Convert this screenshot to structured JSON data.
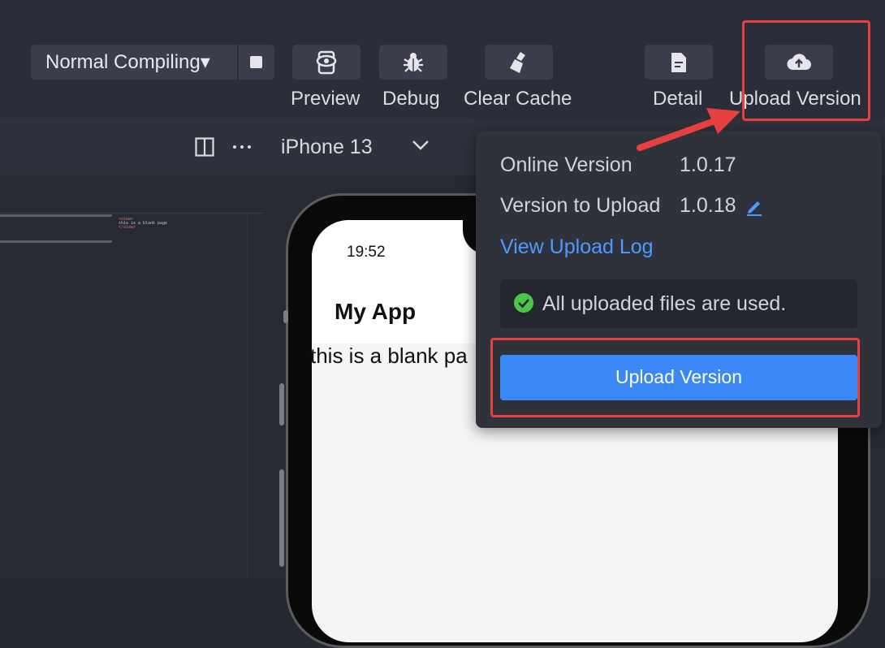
{
  "toolbar": {
    "compile_mode": "Normal Compiling▾",
    "buttons": [
      {
        "label": "Preview",
        "icon": "eye-preview-icon"
      },
      {
        "label": "Debug",
        "icon": "bug-icon"
      },
      {
        "label": "Clear Cache",
        "icon": "broom-icon"
      },
      {
        "label": "Detail",
        "icon": "document-icon"
      },
      {
        "label": "Upload Version",
        "icon": "cloud-upload-icon"
      }
    ]
  },
  "simulator_bar": {
    "device": "iPhone 13"
  },
  "code_editor": {
    "lines": [
      "<view>",
      "  this is a blank page",
      "</view>"
    ]
  },
  "phone": {
    "time": "19:52",
    "app_title": "My App",
    "page_text": "this is a blank pa"
  },
  "upload_popup": {
    "online_version_label": "Online Version",
    "online_version_value": "1.0.17",
    "upload_version_label": "Version to Upload",
    "upload_version_value": "1.0.18",
    "view_log_link": "View Upload Log",
    "notice": "All uploaded files are used.",
    "upload_button": "Upload Version"
  },
  "colors": {
    "accent_blue": "#3b87f5",
    "link_blue": "#4e9bff",
    "highlight_red": "#e84040",
    "success_green": "#4cc54a"
  }
}
